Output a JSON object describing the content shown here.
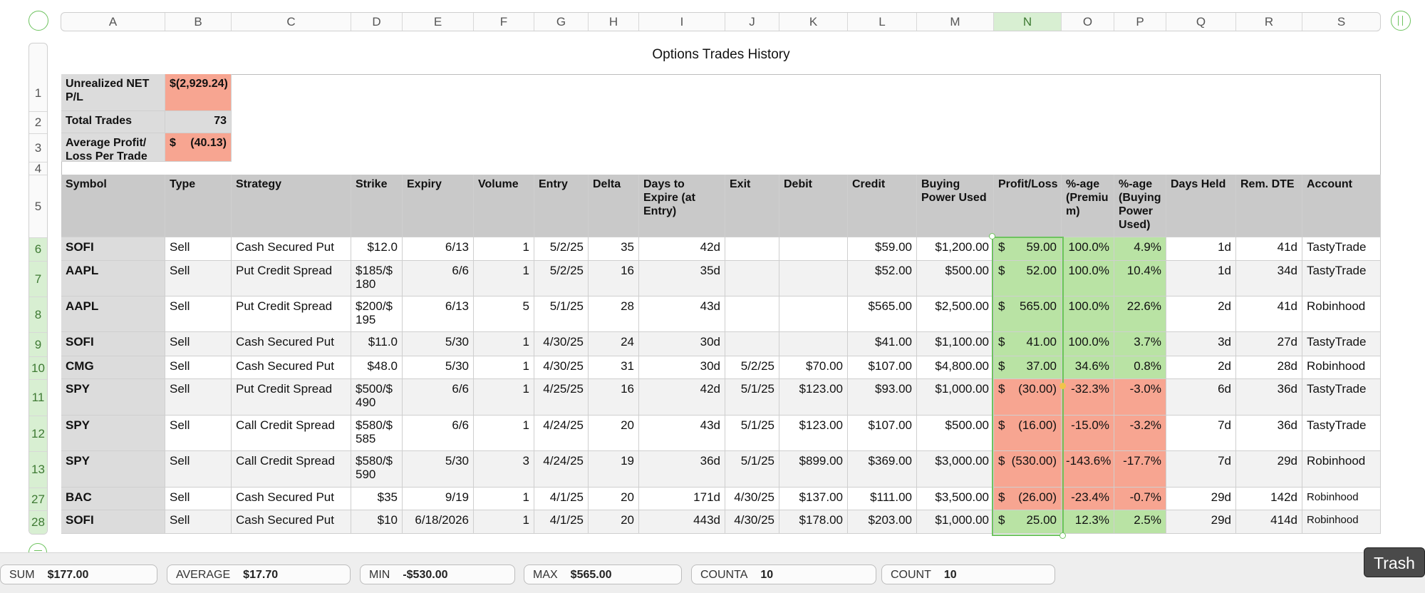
{
  "columns": [
    "A",
    "B",
    "C",
    "D",
    "E",
    "F",
    "G",
    "H",
    "I",
    "J",
    "K",
    "L",
    "M",
    "N",
    "O",
    "P",
    "Q",
    "R",
    "S"
  ],
  "selected_column": "N",
  "rows": [
    "1",
    "2",
    "3",
    "4",
    "5",
    "6",
    "7",
    "8",
    "9",
    "10",
    "11",
    "12",
    "13",
    "27",
    "28"
  ],
  "title": "Options Trades History",
  "summary": [
    {
      "label": "Unrealized NET P/L",
      "value": "$(2,929.24)",
      "highlight": "red"
    },
    {
      "label": "Total Trades",
      "value": "73",
      "highlight": "none"
    },
    {
      "label": "Average Profit/ Loss Per Trade",
      "value_prefix": "$",
      "value": "(40.13)",
      "highlight": "red"
    }
  ],
  "headers": [
    "Symbol",
    "Type",
    "Strategy",
    "Strike",
    "Expiry",
    "Volume",
    "Entry",
    "Delta",
    "Days to Expire (at Entry)",
    "Exit",
    "Debit",
    "Credit",
    "Buying Power Used",
    "Profit/Loss",
    "%-age (Premiu m)",
    "%-age (Buying Power Used)",
    "Days Held",
    "Rem. DTE",
    "Account"
  ],
  "trades": [
    {
      "symbol": "SOFI",
      "type": "Sell",
      "strategy": "Cash Secured Put",
      "strike": "$12.0",
      "expiry": "6/13",
      "volume": "1",
      "entry": "5/2/25",
      "delta": "35",
      "dte": "42d",
      "exit": "",
      "debit": "",
      "credit": "$59.00",
      "bp": "$1,200.00",
      "pl_sign": "$",
      "pl": "59.00",
      "pct_prem": "100.0%",
      "pct_bp": "4.9%",
      "held": "1d",
      "rem": "41d",
      "account": "TastyTrade",
      "status": "green"
    },
    {
      "symbol": "AAPL",
      "type": "Sell",
      "strategy": "Put Credit Spread",
      "strike": "$185/$ 180",
      "expiry": "6/6",
      "volume": "1",
      "entry": "5/2/25",
      "delta": "16",
      "dte": "35d",
      "exit": "",
      "debit": "",
      "credit": "$52.00",
      "bp": "$500.00",
      "pl_sign": "$",
      "pl": "52.00",
      "pct_prem": "100.0%",
      "pct_bp": "10.4%",
      "held": "1d",
      "rem": "34d",
      "account": "TastyTrade",
      "status": "green"
    },
    {
      "symbol": "AAPL",
      "type": "Sell",
      "strategy": "Put Credit Spread",
      "strike": "$200/$ 195",
      "expiry": "6/13",
      "volume": "5",
      "entry": "5/1/25",
      "delta": "28",
      "dte": "43d",
      "exit": "",
      "debit": "",
      "credit": "$565.00",
      "bp": "$2,500.00",
      "pl_sign": "$",
      "pl": "565.00",
      "pct_prem": "100.0%",
      "pct_bp": "22.6%",
      "held": "2d",
      "rem": "41d",
      "account": "Robinhood",
      "status": "green"
    },
    {
      "symbol": "SOFI",
      "type": "Sell",
      "strategy": "Cash Secured Put",
      "strike": "$11.0",
      "expiry": "5/30",
      "volume": "1",
      "entry": "4/30/25",
      "delta": "24",
      "dte": "30d",
      "exit": "",
      "debit": "",
      "credit": "$41.00",
      "bp": "$1,100.00",
      "pl_sign": "$",
      "pl": "41.00",
      "pct_prem": "100.0%",
      "pct_bp": "3.7%",
      "held": "3d",
      "rem": "27d",
      "account": "TastyTrade",
      "status": "green"
    },
    {
      "symbol": "CMG",
      "type": "Sell",
      "strategy": "Cash Secured Put",
      "strike": "$48.0",
      "expiry": "5/30",
      "volume": "1",
      "entry": "4/30/25",
      "delta": "31",
      "dte": "30d",
      "exit": "5/2/25",
      "debit": "$70.00",
      "credit": "$107.00",
      "bp": "$4,800.00",
      "pl_sign": "$",
      "pl": "37.00",
      "pct_prem": "34.6%",
      "pct_bp": "0.8%",
      "held": "2d",
      "rem": "28d",
      "account": "Robinhood",
      "status": "green"
    },
    {
      "symbol": "SPY",
      "type": "Sell",
      "strategy": "Put Credit Spread",
      "strike": "$500/$ 490",
      "expiry": "6/6",
      "volume": "1",
      "entry": "4/25/25",
      "delta": "16",
      "dte": "42d",
      "exit": "5/1/25",
      "debit": "$123.00",
      "credit": "$93.00",
      "bp": "$1,000.00",
      "pl_sign": "$",
      "pl": "(30.00)",
      "pct_prem": "-32.3%",
      "pct_bp": "-3.0%",
      "held": "6d",
      "rem": "36d",
      "account": "TastyTrade",
      "status": "red"
    },
    {
      "symbol": "SPY",
      "type": "Sell",
      "strategy": "Call Credit Spread",
      "strike": "$580/$ 585",
      "expiry": "6/6",
      "volume": "1",
      "entry": "4/24/25",
      "delta": "20",
      "dte": "43d",
      "exit": "5/1/25",
      "debit": "$123.00",
      "credit": "$107.00",
      "bp": "$500.00",
      "pl_sign": "$",
      "pl": "(16.00)",
      "pct_prem": "-15.0%",
      "pct_bp": "-3.2%",
      "held": "7d",
      "rem": "36d",
      "account": "TastyTrade",
      "status": "red"
    },
    {
      "symbol": "SPY",
      "type": "Sell",
      "strategy": "Call Credit Spread",
      "strike": "$580/$ 590",
      "expiry": "5/30",
      "volume": "3",
      "entry": "4/24/25",
      "delta": "19",
      "dte": "36d",
      "exit": "5/1/25",
      "debit": "$899.00",
      "credit": "$369.00",
      "bp": "$3,000.00",
      "pl_sign": "$",
      "pl": "(530.00)",
      "pct_prem": "-143.6%",
      "pct_bp": "-17.7%",
      "held": "7d",
      "rem": "29d",
      "account": "Robinhood",
      "status": "red"
    },
    {
      "symbol": "BAC",
      "type": "Sell",
      "strategy": "Cash Secured Put",
      "strike": "$35",
      "expiry": "9/19",
      "volume": "1",
      "entry": "4/1/25",
      "delta": "20",
      "dte": "171d",
      "exit": "4/30/25",
      "debit": "$137.00",
      "credit": "$111.00",
      "bp": "$3,500.00",
      "pl_sign": "$",
      "pl": "(26.00)",
      "pct_prem": "-23.4%",
      "pct_bp": "-0.7%",
      "held": "29d",
      "rem": "142d",
      "account": "Robinhood",
      "status": "red"
    },
    {
      "symbol": "SOFI",
      "type": "Sell",
      "strategy": "Cash Secured Put",
      "strike": "$10",
      "expiry": "6/18/2026",
      "volume": "1",
      "entry": "4/1/25",
      "delta": "20",
      "dte": "443d",
      "exit": "4/30/25",
      "debit": "$178.00",
      "credit": "$203.00",
      "bp": "$1,000.00",
      "pl_sign": "$",
      "pl": "25.00",
      "pct_prem": "12.3%",
      "pct_bp": "2.5%",
      "held": "29d",
      "rem": "414d",
      "account": "Robinhood",
      "status": "green"
    }
  ],
  "statusbar": [
    {
      "label": "SUM",
      "value": "$177.00"
    },
    {
      "label": "AVERAGE",
      "value": "$17.70"
    },
    {
      "label": "MIN",
      "value": "-$530.00"
    },
    {
      "label": "MAX",
      "value": "$565.00"
    },
    {
      "label": "COUNTA",
      "value": "10"
    },
    {
      "label": "COUNT",
      "value": "10"
    }
  ],
  "trash_label": "Trash",
  "colors": {
    "green": "#b9e3a4",
    "red": "#f7a591",
    "header": "#c9c9c9",
    "selection": "#6ec35f"
  }
}
